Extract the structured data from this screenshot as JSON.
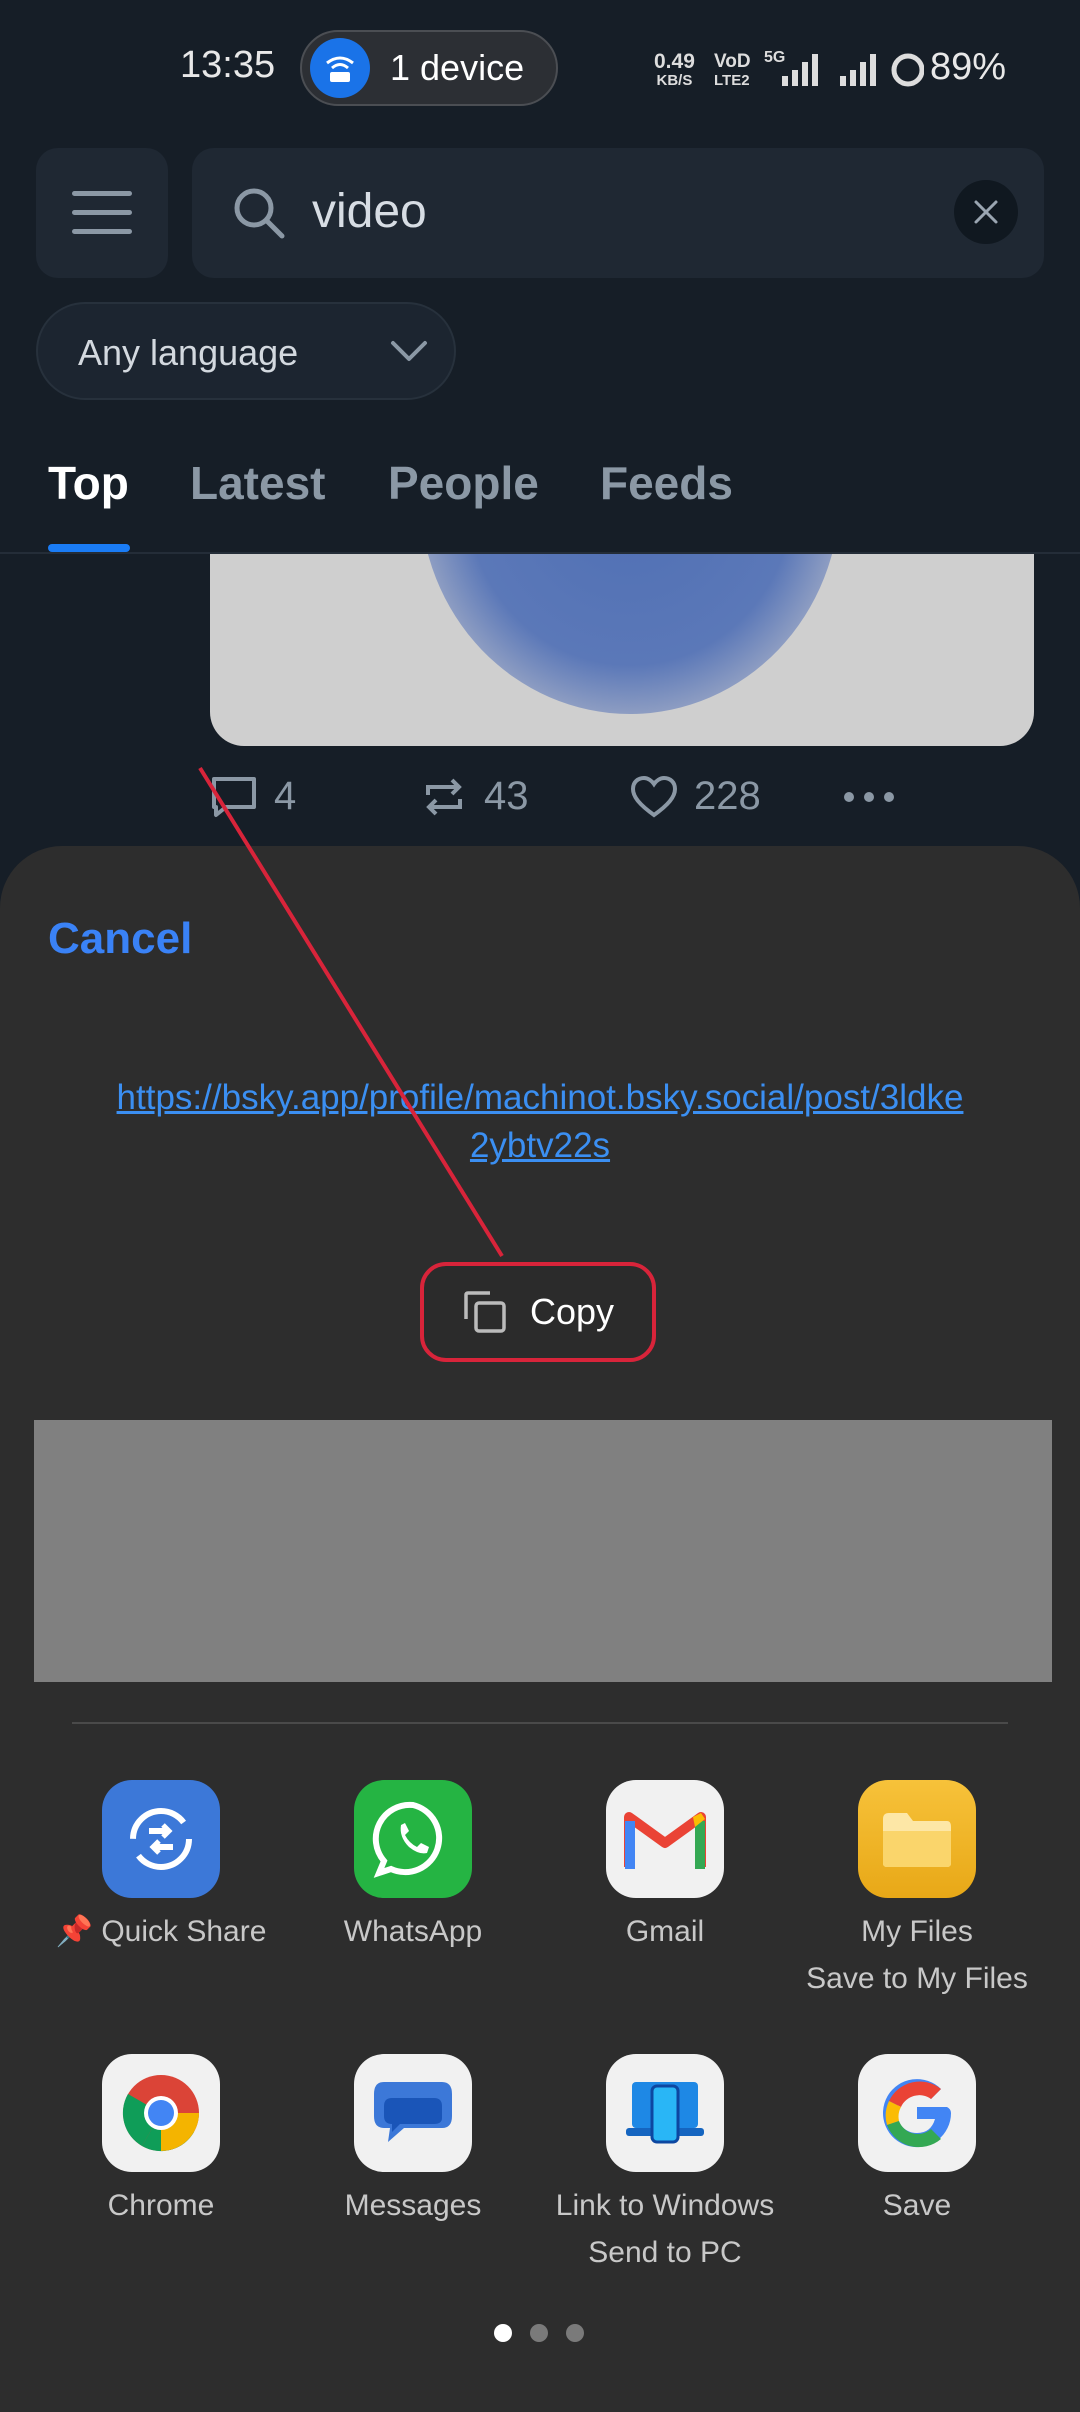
{
  "status_bar": {
    "time": "13:35",
    "hotspot": "1 device",
    "net_speed_value": "0.49",
    "net_speed_unit": "KB/S",
    "volte_top": "VoD",
    "volte_bottom": "LTE2",
    "battery": "89%"
  },
  "search": {
    "query": "video",
    "language": "Any language"
  },
  "tabs": [
    "Top",
    "Latest",
    "People",
    "Feeds"
  ],
  "post": {
    "replies": "4",
    "reposts": "43",
    "likes": "228"
  },
  "share_sheet": {
    "cancel": "Cancel",
    "url": "https://bsky.app/profile/machinot.bsky.social/post/3ldke2ybtv22s",
    "copy": "Copy",
    "apps": [
      {
        "label": "Quick Share",
        "sub": ""
      },
      {
        "label": "WhatsApp",
        "sub": ""
      },
      {
        "label": "Gmail",
        "sub": ""
      },
      {
        "label": "My Files",
        "sub": "Save to My Files"
      },
      {
        "label": "Chrome",
        "sub": ""
      },
      {
        "label": "Messages",
        "sub": ""
      },
      {
        "label": "Link to Windows",
        "sub": "Send to PC"
      },
      {
        "label": "Save",
        "sub": ""
      }
    ],
    "page_dots": 3,
    "active_dot": 0
  },
  "colors": {
    "accent": "#1a7cf5",
    "cancel": "#3a82f6",
    "annotation": "#d8243a"
  }
}
